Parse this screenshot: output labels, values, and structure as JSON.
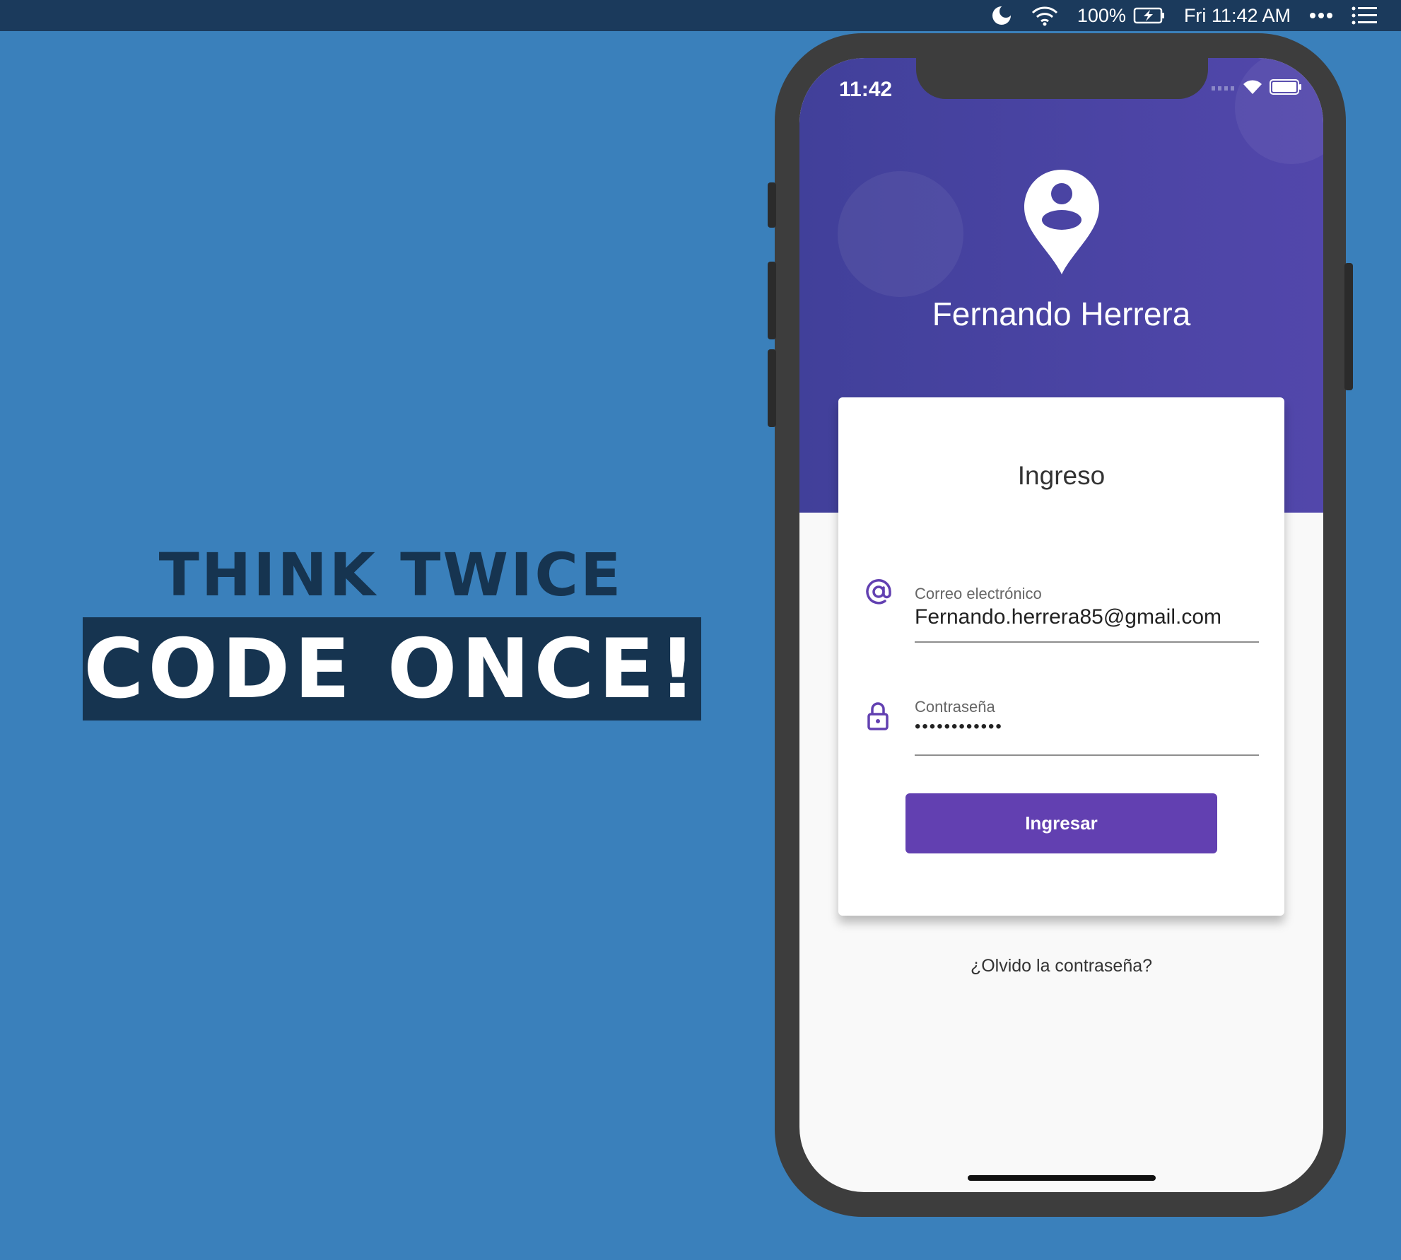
{
  "menubar": {
    "battery": "100%",
    "clock": "Fri 11:42 AM",
    "icons": [
      "moon-icon",
      "wifi-icon",
      "battery-charging-icon",
      "more-icon",
      "list-icon"
    ]
  },
  "slogan": {
    "line1": "THINK TWICE",
    "line2": "CODE ONCE!"
  },
  "phone": {
    "status_time": "11:42",
    "profile_name": "Fernando Herrera",
    "card_title": "Ingreso",
    "email_label": "Correo electrónico",
    "email_value": "Fernando.herrera85@gmail.com",
    "password_label": "Contraseña",
    "password_value": "••••••••••••",
    "submit_label": "Ingresar",
    "forgot_label": "¿Olvido la contraseña?"
  },
  "colors": {
    "desktop": "#3a80bb",
    "header_start": "#41409a",
    "header_end": "#5247ab",
    "accent": "#6240b1",
    "slogan_dark": "#163450"
  }
}
